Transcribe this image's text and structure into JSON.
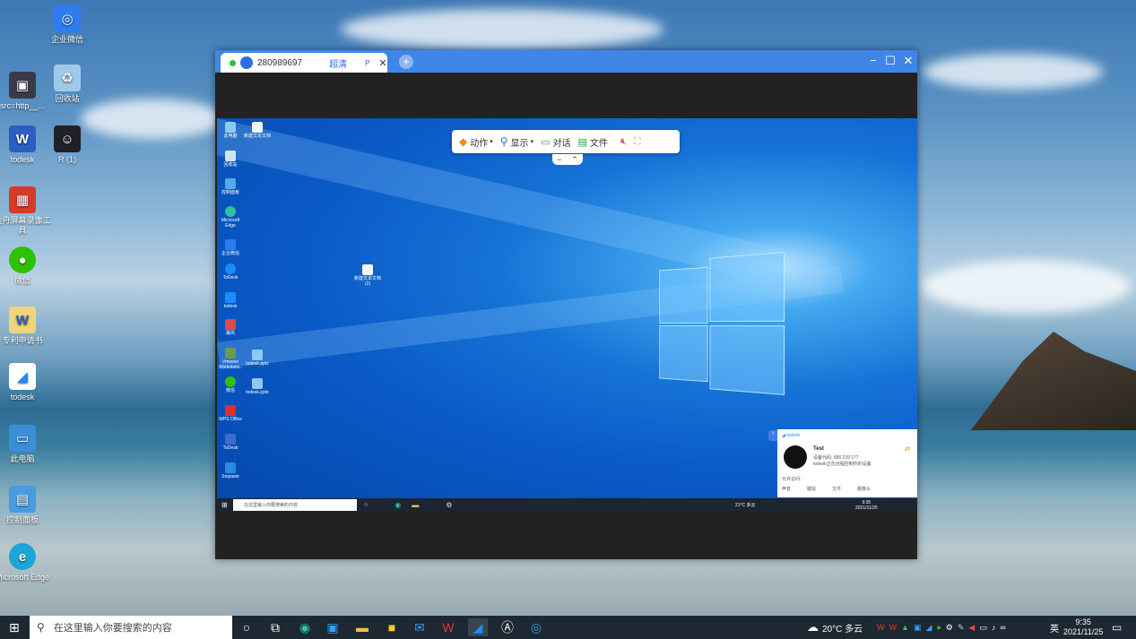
{
  "desktop": {
    "icons": [
      {
        "label": "企业微信"
      },
      {
        "label": "src=http__..."
      },
      {
        "label": "回收站"
      },
      {
        "label": "todesk"
      },
      {
        "label": "R (1)"
      },
      {
        "label": "金舟屏幕录像工具"
      },
      {
        "label": "微信"
      },
      {
        "label": "专利申请书"
      },
      {
        "label": "todesk"
      },
      {
        "label": "此电脑"
      },
      {
        "label": "控制面板"
      },
      {
        "label": "Microsoft Edge"
      }
    ]
  },
  "window": {
    "tab": {
      "id": "280989697",
      "quality": "超清",
      "extra": "P"
    },
    "toolbar": {
      "action": "动作",
      "display": "显示",
      "chat": "对话",
      "file": "文件"
    },
    "collapse_minus": "−",
    "collapse_up": "⌃"
  },
  "remote": {
    "icons": [
      "此电脑",
      "回收站",
      "控制面板",
      "Microsoft Edge",
      "企业微信",
      "ToDesk",
      "todesk",
      "暴风",
      "Vmware Workstatio..",
      "微信",
      "WPS Office",
      "ToDesk",
      "Snipaste"
    ],
    "file_icons": [
      "新建文本文档",
      "新建文本文档 (2)",
      "todesk.pptx",
      "todesk.pptx"
    ],
    "popup": {
      "brand": "todesk",
      "name": "Test",
      "code": "设备代码: 586 239 177",
      "note": "todesk正在远程控制你的设备",
      "allow": "允许访问:",
      "perms": [
        "声音",
        "键鼠",
        "文件",
        "摄像头"
      ]
    },
    "taskbar": {
      "search": "在这里输入你要搜索的内容",
      "weather": "21°C 多云",
      "time": "9:35",
      "date": "2021/11/25"
    }
  },
  "taskbar": {
    "search_placeholder": "在这里输入你要搜索的内容",
    "weather": "20°C 多云",
    "lang": "英",
    "time": "9:35",
    "date": "2021/11/25"
  },
  "colors": {
    "titlebar": "#3f86e8",
    "taskbar": "#1e2833"
  }
}
